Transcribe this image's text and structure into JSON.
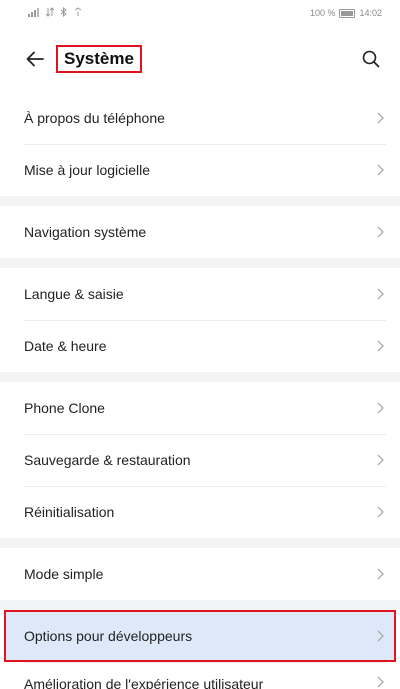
{
  "status": {
    "left_icons": [
      "signal-icon",
      "data-icon",
      "bluetooth-icon",
      "wifi-icon"
    ],
    "battery_percent": "100 %",
    "time": "14:02"
  },
  "header": {
    "title": "Système"
  },
  "groups": [
    {
      "items": [
        {
          "label": "À propos du téléphone"
        },
        {
          "label": "Mise à jour logicielle"
        }
      ]
    },
    {
      "items": [
        {
          "label": "Navigation système"
        }
      ]
    },
    {
      "items": [
        {
          "label": "Langue & saisie"
        },
        {
          "label": "Date & heure"
        }
      ]
    },
    {
      "items": [
        {
          "label": "Phone Clone"
        },
        {
          "label": "Sauvegarde & restauration"
        },
        {
          "label": "Réinitialisation"
        }
      ]
    },
    {
      "items": [
        {
          "label": "Mode simple"
        }
      ]
    },
    {
      "items": [
        {
          "label": "Options pour développeurs",
          "highlighted": true
        },
        {
          "label": "Amélioration de l'expérience utilisateur"
        }
      ]
    }
  ],
  "colors": {
    "highlight_border": "#e0121e",
    "highlight_bg": "#dde9f8",
    "background": "#f1f3f5"
  }
}
